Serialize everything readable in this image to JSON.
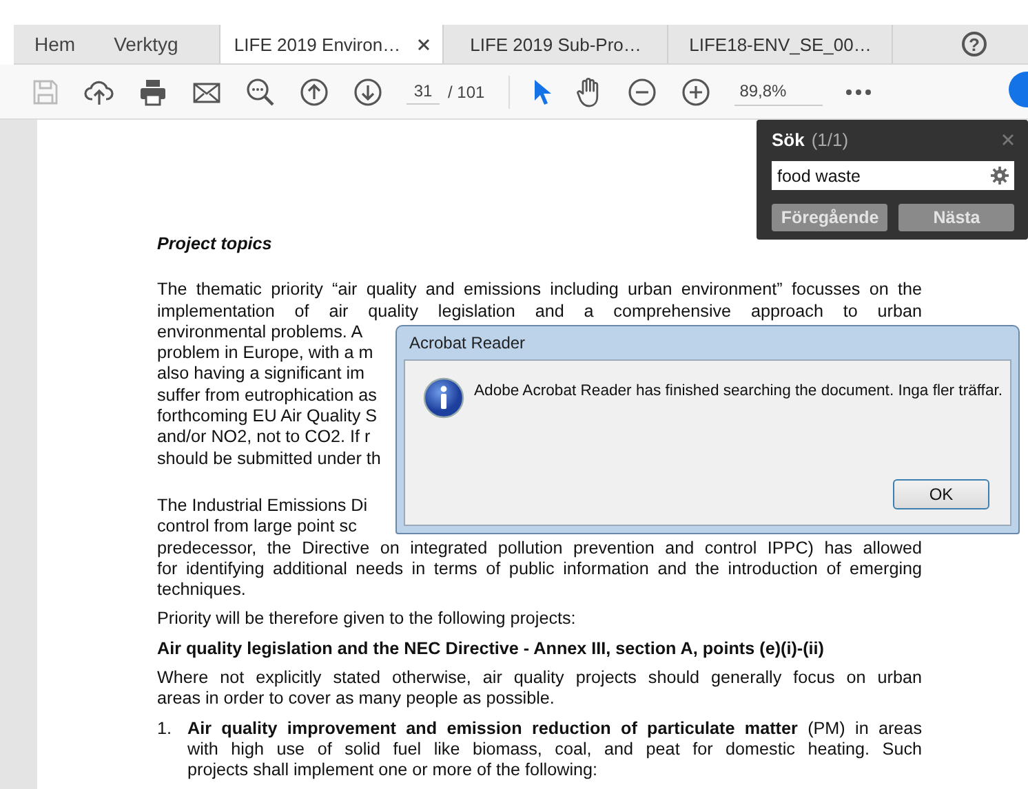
{
  "nav_tabs": [
    {
      "label": "Hem"
    },
    {
      "label": "Verktyg"
    }
  ],
  "doc_tabs": [
    {
      "label": "LIFE 2019 Environ…",
      "selected": true
    },
    {
      "label": "LIFE 2019 Sub-Pro…",
      "selected": false
    },
    {
      "label": "LIFE18-ENV_SE_00…",
      "selected": false
    }
  ],
  "help": {
    "glyph": "?"
  },
  "toolbar": {
    "page": "31",
    "total": "/ 101",
    "zoom": "89,8%",
    "tools": [
      {
        "kind": "select",
        "selected": true
      },
      {
        "kind": "hand",
        "selected": false
      }
    ]
  },
  "search": {
    "title": "Sök",
    "count": "(1/1)",
    "value": "food waste",
    "buttons": [
      "Föregående",
      "Nästa"
    ]
  },
  "document": {
    "heading": "Project topics",
    "blocks": [
      {
        "kind": "para",
        "lines": [
          {
            "text": "The thematic priority “air quality and emissions including urban environment” focusses on the",
            "kind": "full"
          },
          {
            "text": "implementation of air quality legislation and a comprehensive approach to urban",
            "kind": "full"
          },
          {
            "text": "environmental problems. A",
            "kind": "cut"
          },
          {
            "text": "problem in Europe, with a m",
            "kind": "cut"
          },
          {
            "text": "also having a significant im",
            "kind": "cut"
          },
          {
            "text": "suffer from eutrophication as",
            "kind": "cut"
          },
          {
            "text": "forthcoming EU Air Quality S",
            "kind": "cut"
          },
          {
            "text": "and/or NO2, not to CO2. If r",
            "kind": "cut"
          },
          {
            "text": "should be submitted under th",
            "kind": "cut"
          }
        ]
      },
      {
        "kind": "para",
        "lines": [
          {
            "text": "The Industrial Emissions Di",
            "kind": "cut"
          },
          {
            "text": "control from large point sc",
            "kind": "cut"
          },
          {
            "text": "predecessor, the Directive on integrated pollution prevention and control IPPC) has allowed",
            "kind": "full"
          },
          {
            "text": "for identifying additional needs in terms of public information and the introduction of emerging",
            "kind": "full"
          },
          {
            "text": "techniques.",
            "kind": "last"
          }
        ]
      },
      {
        "kind": "para",
        "lines": [
          {
            "text": "Priority will be therefore given to the following projects:",
            "kind": "last"
          }
        ]
      },
      {
        "kind": "subheading",
        "lines": [
          {
            "text": "Air quality legislation and the NEC Directive - Annex III, section A, points (e)(i)-(ii)",
            "kind": "last"
          }
        ]
      },
      {
        "kind": "para",
        "lines": [
          {
            "text": "Where not explicitly stated otherwise, air quality projects should generally focus on urban",
            "kind": "full"
          },
          {
            "text": "areas in order to cover as many people as possible.",
            "kind": "last"
          }
        ]
      },
      {
        "kind": "item",
        "number": "1.",
        "lines": [
          {
            "text": "**Air quality improvement and emission reduction of particulate matter** (PM) in areas",
            "kind": "full"
          },
          {
            "text": "with high use of solid fuel like biomass, coal, and peat for domestic heating. Such",
            "kind": "full"
          },
          {
            "text": "projects shall implement one or more of the following:",
            "kind": "last"
          }
        ]
      }
    ]
  },
  "dialog": {
    "title": "Acrobat Reader",
    "message": "Adobe Acrobat Reader has finished searching the document. Inga fler träffar.",
    "button": "OK"
  }
}
